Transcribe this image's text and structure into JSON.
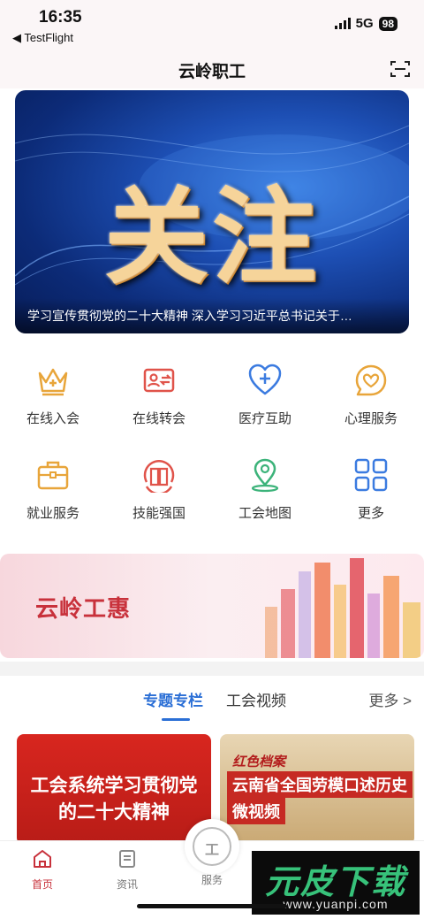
{
  "status": {
    "time": "16:35",
    "back_app": "◀ TestFlight",
    "network": "5G",
    "battery": "98"
  },
  "header": {
    "title": "云岭职工"
  },
  "banner": {
    "headline": "关注",
    "caption": "学习宣传贯彻党的二十大精神 深入学习习近平总书记关于…"
  },
  "services": [
    {
      "label": "在线入会",
      "icon": "crown-plus-icon"
    },
    {
      "label": "在线转会",
      "icon": "id-card-transfer-icon"
    },
    {
      "label": "医疗互助",
      "icon": "heart-plus-icon"
    },
    {
      "label": "心理服务",
      "icon": "heart-chat-icon"
    },
    {
      "label": "就业服务",
      "icon": "briefcase-icon"
    },
    {
      "label": "技能强国",
      "icon": "book-circle-icon"
    },
    {
      "label": "工会地图",
      "icon": "map-pin-icon"
    },
    {
      "label": "更多",
      "icon": "grid-icon"
    }
  ],
  "promo": {
    "text": "云岭工惠"
  },
  "section_tabs": {
    "tabs": [
      "专题专栏",
      "工会视频"
    ],
    "more": "更多 >"
  },
  "cards": [
    {
      "title": "工会系统学习贯彻党的二十大精神"
    },
    {
      "script": "红色档案",
      "title_line1": "云南省全国劳模口述历史",
      "title_line2": "微视频"
    }
  ],
  "tabbar": {
    "items": [
      "首页",
      "资讯",
      "服务"
    ]
  },
  "watermark": {
    "brand": "元皮下载",
    "url": "www.yuanpi.com"
  },
  "colors": {
    "accent_blue": "#2b6fd6",
    "brand_red": "#c8313b",
    "icon_gold": "#e8a53a",
    "icon_red": "#e0534a",
    "icon_green": "#3cb37a",
    "icon_blue": "#3b7be0"
  }
}
